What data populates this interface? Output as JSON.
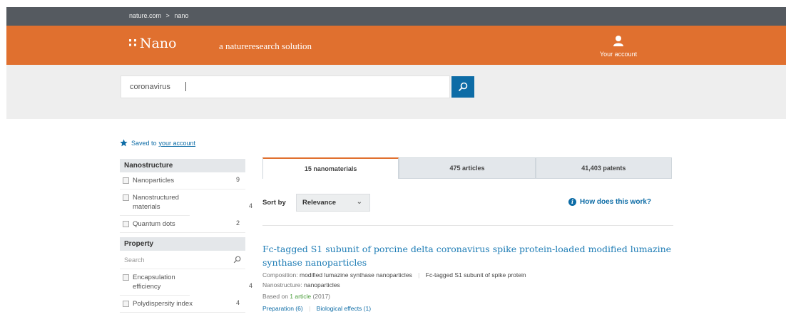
{
  "breadcrumb": {
    "root": "nature.com",
    "separator": ">",
    "current": "nano"
  },
  "brand": {
    "mark": "∷",
    "name": "Nano",
    "tagline": "a natureresearch solution"
  },
  "account": {
    "label": "Your account",
    "icon": "user-icon"
  },
  "search": {
    "value": "coronavirus",
    "button_icon": "search-icon"
  },
  "saved": {
    "text": "Saved to",
    "link": "your account",
    "icon": "star-icon"
  },
  "sidebar": {
    "nanostructure": {
      "title": "Nanostructure",
      "items": [
        {
          "label": "Nanoparticles",
          "count": "9"
        },
        {
          "label": "Nanostructured materials",
          "count": "4"
        },
        {
          "label": "Quantum dots",
          "count": "2"
        }
      ]
    },
    "property": {
      "title": "Property",
      "search_placeholder": "Search",
      "items": [
        {
          "label": "Encapsulation efficiency",
          "count": "4"
        },
        {
          "label": "Polydispersity index",
          "count": "4"
        }
      ]
    }
  },
  "tabs": [
    {
      "label": "15 nanomaterials",
      "active": true
    },
    {
      "label": "475 articles",
      "active": false
    },
    {
      "label": "41,403 patents",
      "active": false
    }
  ],
  "sort": {
    "label": "Sort by",
    "value": "Relevance"
  },
  "help_link": "How does this work?",
  "result": {
    "title": "Fc-tagged S1 subunit of porcine delta coronavirus spike protein-loaded modified lumazine synthase nanoparticles",
    "composition_label": "Composition:",
    "composition_1": "modified lumazine synthase nanoparticles",
    "composition_2": "Fc-tagged S1 subunit of spike protein",
    "nanostructure_label": "Nanostructure:",
    "nanostructure": "nanoparticles",
    "based_on": "Based on",
    "article_link": "1 article",
    "year": "(2017)",
    "links": [
      "Preparation (6)",
      "Biological effects (1)"
    ]
  },
  "colors": {
    "brand_orange": "#e0702f",
    "topbar": "#555a60",
    "link_blue": "#0d6ca6"
  }
}
